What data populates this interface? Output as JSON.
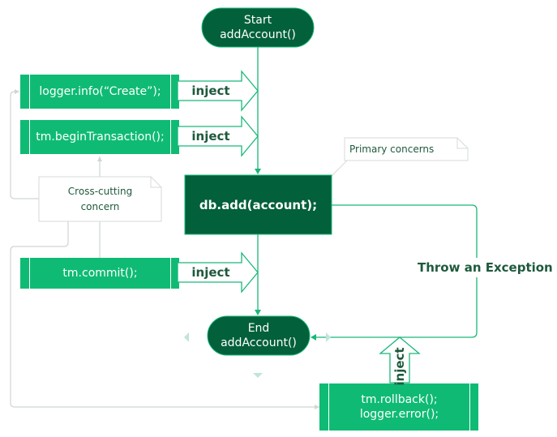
{
  "colors": {
    "dark_green": "#02603b",
    "aspect_green": "#0fbb74",
    "line_green": "#1ab77a",
    "text_green": "#1e5a3c",
    "note_border": "#d5dbd8",
    "gray_line": "#cfd6d2",
    "faint_arrow": "#bfe6d9"
  },
  "start": {
    "text": "Start\naddAccount()"
  },
  "end": {
    "text": "End\naddAccount()"
  },
  "primary": {
    "text": "db.add(account);"
  },
  "aspects": [
    {
      "text": "logger.info(“Create”);"
    },
    {
      "text": "tm.beginTransaction();"
    },
    {
      "text": "tm.commit();"
    },
    {
      "text": "tm.rollback();\nlogger.error();"
    }
  ],
  "inject_label": "inject",
  "notes": {
    "primary": "Primary concerns",
    "cross_cutting": "Cross-cutting\nconcern"
  },
  "exception_label": "Throw an Exception"
}
